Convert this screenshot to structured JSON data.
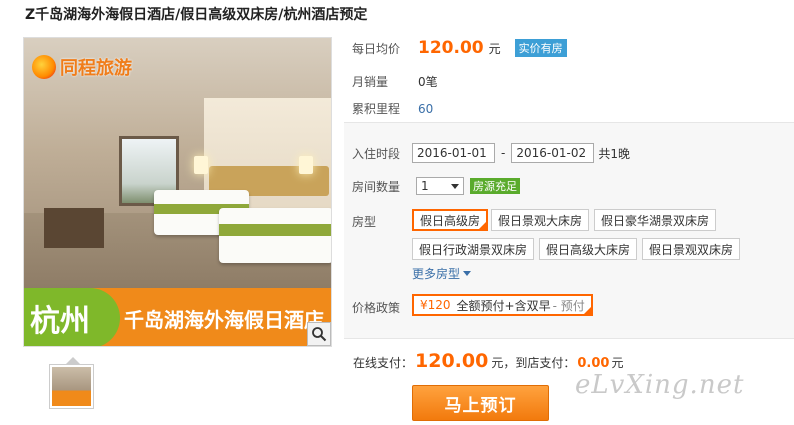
{
  "page_title": "Z千岛湖海外海假日酒店/假日高级双床房/杭州酒店预定",
  "gallery": {
    "logo_text": "同程旅游",
    "banner_city": "杭州",
    "banner_hotel": "千岛湖海外海假日酒店",
    "zoom_icon": "magnifier-icon"
  },
  "summary": {
    "avg_price_label": "每日均价",
    "avg_price_value": "120.00",
    "avg_price_unit": "元",
    "realtime_badge": "实价有房",
    "monthly_sales_label": "月销量",
    "monthly_sales_value": "0笔",
    "mileage_label": "累积里程",
    "mileage_value": "60"
  },
  "booking": {
    "checkin_label": "入住时段",
    "checkin_date": "2016-01-01",
    "checkout_date": "2016-01-02",
    "date_separator": "-",
    "nights_text": "共1晚",
    "rooms_label": "房间数量",
    "rooms_value": "1",
    "stock_badge": "房源充足",
    "room_type_label": "房型",
    "room_types": [
      "假日高级房",
      "假日景观大床房",
      "假日豪华湖景双床房",
      "假日行政湖景双床房",
      "假日高级大床房",
      "假日景观双床房"
    ],
    "more_room_types": "更多房型",
    "policy_label": "价格政策",
    "policy_price": "¥120",
    "policy_text": "全额预付+含双早",
    "policy_tag": "- 预付"
  },
  "payment": {
    "online_label": "在线支付：",
    "online_amount": "120.00",
    "online_unit": "元",
    "hotel_label": "，到店支付：",
    "hotel_amount": "0.00",
    "hotel_unit": "元",
    "book_button": "马上预订"
  },
  "watermark": "eLvXing.net",
  "colors": {
    "accent": "#ff6600",
    "link": "#3a6fa8",
    "badge_blue": "#3d9fd6",
    "badge_green": "#5aab2c",
    "banner_orange": "#f08a1a",
    "banner_green": "#7fb82a"
  }
}
